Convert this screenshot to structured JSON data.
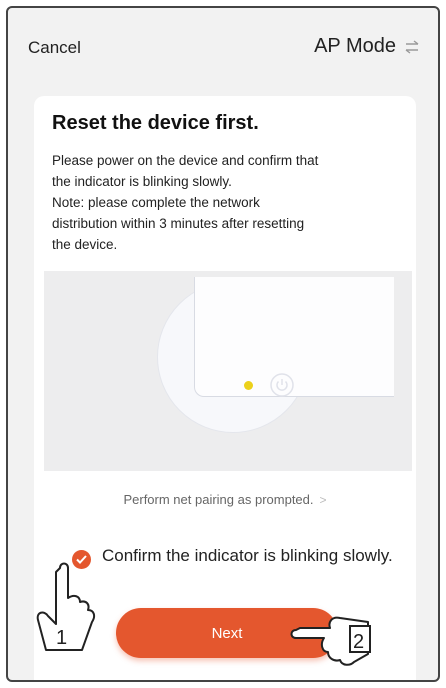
{
  "header": {
    "cancel_label": "Cancel",
    "mode_label": "AP Mode",
    "mode_icon": "swap-icon"
  },
  "card": {
    "title": "Reset the device first.",
    "description": "Please power on the device and confirm that\nthe indicator is blinking slowly.\nNote: please complete the network\ndistribution within 3 minutes after resetting\nthe device.",
    "illustration": {
      "led_color": "#ecd11b",
      "icon": "power-icon"
    },
    "prompt_link": "Perform net pairing as prompted.",
    "prompt_arrow": ">",
    "confirm": {
      "checked": true,
      "label": "Confirm the indicator is blinking slowly."
    },
    "next_label": "Next"
  },
  "annotations": {
    "step1_label": "1",
    "step2_label": "2"
  },
  "colors": {
    "accent": "#e4572e",
    "background": "#f2f2f2",
    "card": "#ffffff"
  }
}
